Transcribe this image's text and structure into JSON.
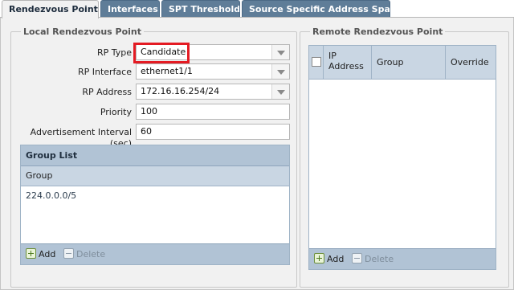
{
  "tabs": [
    {
      "label": "Rendezvous Point",
      "active": true
    },
    {
      "label": "Interfaces",
      "active": false
    },
    {
      "label": "SPT Threshold",
      "active": false
    },
    {
      "label": "Source Specific Address Space",
      "active": false
    }
  ],
  "local": {
    "legend": "Local Rendezvous Point",
    "rp_type": {
      "label": "RP Type",
      "value": "Candidate"
    },
    "rp_interface": {
      "label": "RP Interface",
      "value": "ethernet1/1"
    },
    "rp_address": {
      "label": "RP Address",
      "value": "172.16.16.254/24"
    },
    "priority": {
      "label": "Priority",
      "value": "100"
    },
    "adv_interval": {
      "label": "Advertisement Interval (sec)",
      "value": "60"
    },
    "group_list": {
      "title": "Group List",
      "column": "Group",
      "rows": [
        "224.0.0.0/5"
      ],
      "add_label": "Add",
      "delete_label": "Delete"
    }
  },
  "remote": {
    "legend": "Remote Rendezvous Point",
    "columns": [
      "IP Address",
      "Group",
      "Override"
    ],
    "rows": [],
    "add_label": "Add",
    "delete_label": "Delete"
  },
  "colors": {
    "tab_inactive": "#5f7d98",
    "grid_header": "#b1c3d5",
    "highlight": "#e41b23"
  }
}
